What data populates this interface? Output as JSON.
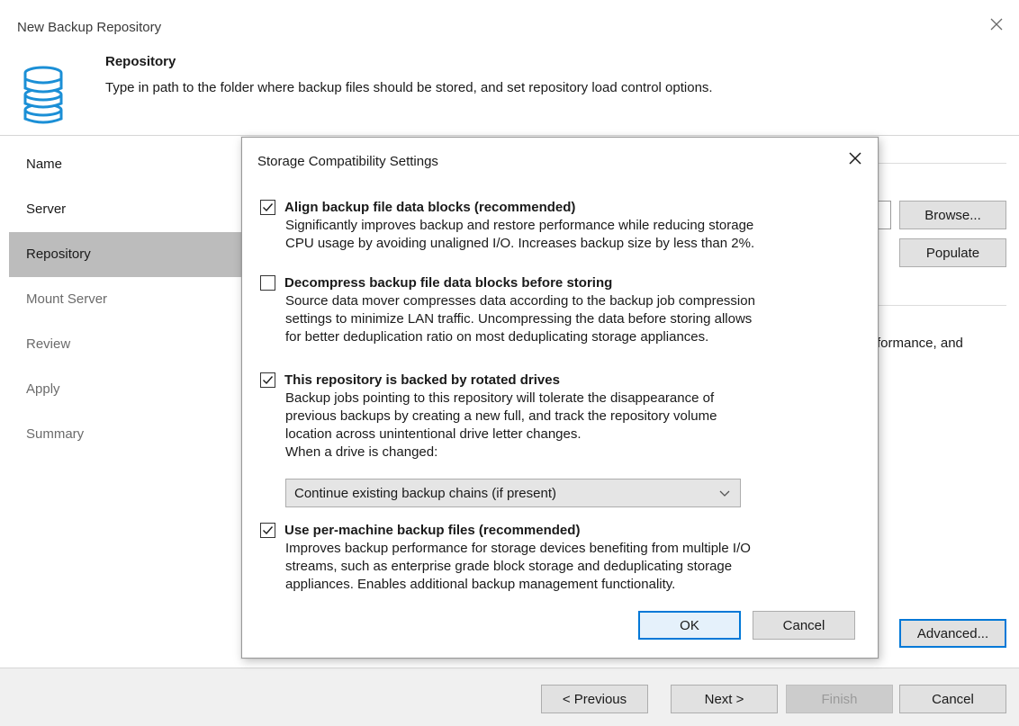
{
  "window": {
    "title": "New Backup Repository"
  },
  "header": {
    "title": "Repository",
    "description": "Type in path to the folder where backup files should be stored, and set repository load control options.",
    "icon": "database-icon"
  },
  "nav": {
    "items": [
      {
        "label": "Name",
        "state": "enabled"
      },
      {
        "label": "Server",
        "state": "enabled"
      },
      {
        "label": "Repository",
        "state": "active"
      },
      {
        "label": "Mount Server",
        "state": "disabled"
      },
      {
        "label": "Review",
        "state": "disabled"
      },
      {
        "label": "Apply",
        "state": "disabled"
      },
      {
        "label": "Summary",
        "state": "disabled"
      }
    ]
  },
  "main": {
    "browse_label": "Browse...",
    "populate_label": "Populate",
    "partial_text": "formance, and",
    "advanced_label": "Advanced..."
  },
  "footer": {
    "previous_label": "< Previous",
    "next_label": "Next >",
    "finish_label": "Finish",
    "cancel_label": "Cancel"
  },
  "dialog": {
    "title": "Storage Compatibility Settings",
    "options": [
      {
        "label": "Align backup file data blocks (recommended)",
        "checked": true,
        "description": [
          "Significantly improves backup and restore performance while reducing storage",
          "CPU usage by avoiding unaligned I/O. Increases backup size by less than 2%."
        ]
      },
      {
        "label": "Decompress backup file data blocks before storing",
        "checked": false,
        "description": [
          "Source data mover compresses data according to the backup job compression",
          "settings to minimize LAN traffic. Uncompressing the data before storing allows",
          "for better deduplication ratio on most deduplicating storage appliances."
        ]
      },
      {
        "label": "This repository is backed by rotated drives",
        "checked": true,
        "description": [
          "Backup jobs pointing to this repository will tolerate the disappearance of",
          "previous backups by creating a new full, and track the repository volume",
          "location across unintentional drive letter changes.",
          "When a drive is changed:"
        ]
      },
      {
        "label": "Use per-machine backup files (recommended)",
        "checked": true,
        "description": [
          "Improves backup performance for storage devices benefiting from multiple I/O",
          "streams, such as enterprise grade block storage and deduplicating storage",
          "appliances. Enables additional backup management functionality."
        ]
      }
    ],
    "drive_change_select": {
      "value": "Continue existing backup chains (if present)"
    },
    "ok_label": "OK",
    "cancel_label": "Cancel"
  },
  "colors": {
    "accent": "#0078d7",
    "nav_active_bg": "#bcbcbc",
    "footer_bg": "#f0f0f0",
    "icon_blue": "#1b8fd6"
  }
}
